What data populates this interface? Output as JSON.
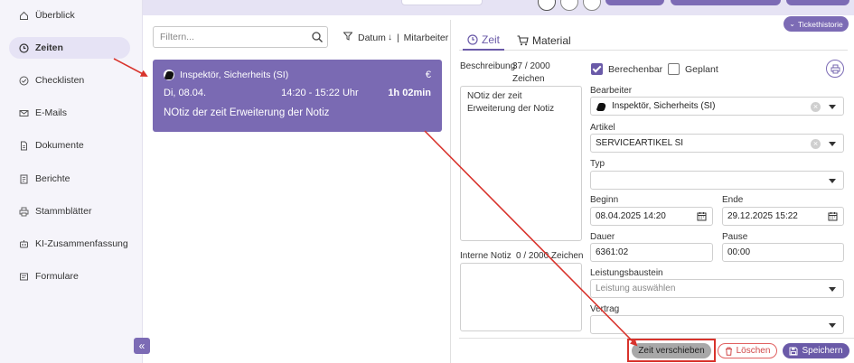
{
  "sidebar": {
    "items": [
      {
        "label": "Überblick",
        "icon": "home-icon"
      },
      {
        "label": "Zeiten",
        "icon": "clock-icon"
      },
      {
        "label": "Checklisten",
        "icon": "check-circle-icon"
      },
      {
        "label": "E-Mails",
        "icon": "envelope-icon"
      },
      {
        "label": "Dokumente",
        "icon": "document-icon"
      },
      {
        "label": "Berichte",
        "icon": "report-icon"
      },
      {
        "label": "Stammblätter",
        "icon": "printer-icon"
      },
      {
        "label": "KI-Zusammenfassung",
        "icon": "robot-icon"
      },
      {
        "label": "Formulare",
        "icon": "form-icon"
      }
    ],
    "active_item": "Zeiten",
    "collapse_label": "«"
  },
  "list": {
    "filter_placeholder": "Filtern...",
    "sort_label": "Datum",
    "sort_arrow": "↓",
    "employee_label": "Mitarbeiter",
    "entries": [
      {
        "employee": "Inspektör, Sicherheits (SI)",
        "billable_symbol": "€",
        "date": "Di, 08.04.",
        "time_range": "14:20 - 15:22 Uhr",
        "duration": "1h 02min",
        "note": "NOtiz der zeit Erweiterung der Notiz"
      }
    ]
  },
  "detail": {
    "tabs": [
      {
        "label": "Zeit",
        "active": true
      },
      {
        "label": "Material",
        "active": false
      }
    ],
    "history_button": "Tickethistorie",
    "description": {
      "label": "Beschreibung",
      "counter": "37 / 2000",
      "counter_suffix": "Zeichen",
      "lines": [
        "NOtiz der zeit",
        "Erweiterung der Notiz"
      ]
    },
    "internal_note": {
      "label": "Interne Notiz",
      "counter": "0 / 2000 Zeichen",
      "value": ""
    },
    "checkboxes": [
      {
        "label": "Berechenbar",
        "checked": true
      },
      {
        "label": "Geplant",
        "checked": false
      }
    ],
    "fields": {
      "bearbeiter": {
        "label": "Bearbeiter",
        "value": "Inspektör, Sicherheits (SI)"
      },
      "artikel": {
        "label": "Artikel",
        "value": "SERVICEARTIKEL SI"
      },
      "typ": {
        "label": "Typ",
        "value": ""
      },
      "beginn": {
        "label": "Beginn",
        "value": "08.04.2025 14:20"
      },
      "ende": {
        "label": "Ende",
        "value": "29.12.2025 15:22"
      },
      "dauer": {
        "label": "Dauer",
        "value": "6361:02"
      },
      "pause": {
        "label": "Pause",
        "value": "00:00"
      },
      "leistungsbaustein": {
        "label": "Leistungsbaustein",
        "placeholder": "Leistung auswählen"
      },
      "vertrag": {
        "label": "Vertrag",
        "value": ""
      }
    },
    "footer": {
      "move_button": "Zeit verschieben",
      "delete_button": "Löschen",
      "save_button": "Speichern"
    }
  },
  "colors": {
    "accent": "#6a5aa8",
    "card": "#7a6ab3",
    "annotation": "#d8332c",
    "delete": "#d04848"
  }
}
